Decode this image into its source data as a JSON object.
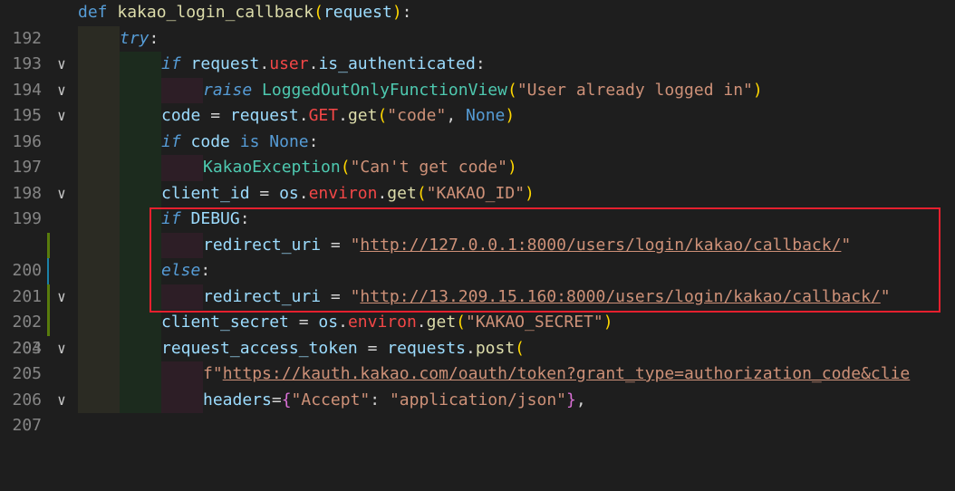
{
  "editor": {
    "lines": [
      {
        "n": "192",
        "fold": "∨"
      },
      {
        "n": "193",
        "fold": "∨"
      },
      {
        "n": "194",
        "fold": "∨"
      },
      {
        "n": "195",
        "fold": ""
      },
      {
        "n": "196",
        "fold": ""
      },
      {
        "n": "197",
        "fold": "∨"
      },
      {
        "n": "198",
        "fold": ""
      },
      {
        "n": "199",
        "fold": ""
      },
      {
        "n": "200",
        "fold": "∨"
      },
      {
        "n": "201",
        "fold": ""
      },
      {
        "n": "202",
        "fold": "∨"
      },
      {
        "n": "203",
        "fold": ""
      },
      {
        "n": "204",
        "fold": ""
      },
      {
        "n": "205",
        "fold": "∨"
      },
      {
        "n": "206",
        "fold": ""
      },
      {
        "n": "207",
        "fold": ""
      }
    ],
    "tokens": {
      "def": "def",
      "func_name": "kakao_login_callback",
      "request": "request",
      "try": "try",
      "if": "if",
      "user": "user",
      "is_authenticated": "is_authenticated",
      "raise": "raise",
      "exc_class": "LoggedOutOnlyFunctionView",
      "already_msg": "\"User already logged in\"",
      "code": "code",
      "get_attr": "GET",
      "get": "get",
      "code_str": "\"code\"",
      "none": "None",
      "is": "is",
      "kakao_exc": "KakaoException",
      "cant_get": "\"Can't get code\"",
      "client_id": "client_id",
      "os": "os",
      "environ": "environ",
      "kakao_id_str": "\"KAKAO_ID\"",
      "debug": "DEBUG",
      "redirect_uri": "redirect_uri",
      "url_local": "http://127.0.0.1:8000/users/login/kakao/callback/",
      "else": "else",
      "url_prod": "http://13.209.15.160:8000/users/login/kakao/callback/",
      "client_secret": "client_secret",
      "kakao_secret_str": "\"KAKAO_SECRET\"",
      "request_access_token": "request_access_token",
      "requests": "requests",
      "post": "post",
      "fstr_prefix": "f\"",
      "token_url": "https://kauth.kakao.com/oauth/token?grant_type=authorization_code&clie",
      "headers": "headers",
      "accept": "\"Accept\"",
      "app_json": "\"application/json\""
    }
  },
  "colors": {
    "background": "#1e1e1e",
    "keyword": "#569cd6",
    "function": "#dcdcaa",
    "class": "#4ec9b0",
    "string": "#ce9178",
    "variable": "#9cdcfe",
    "highlight_box": "#e5202e"
  }
}
